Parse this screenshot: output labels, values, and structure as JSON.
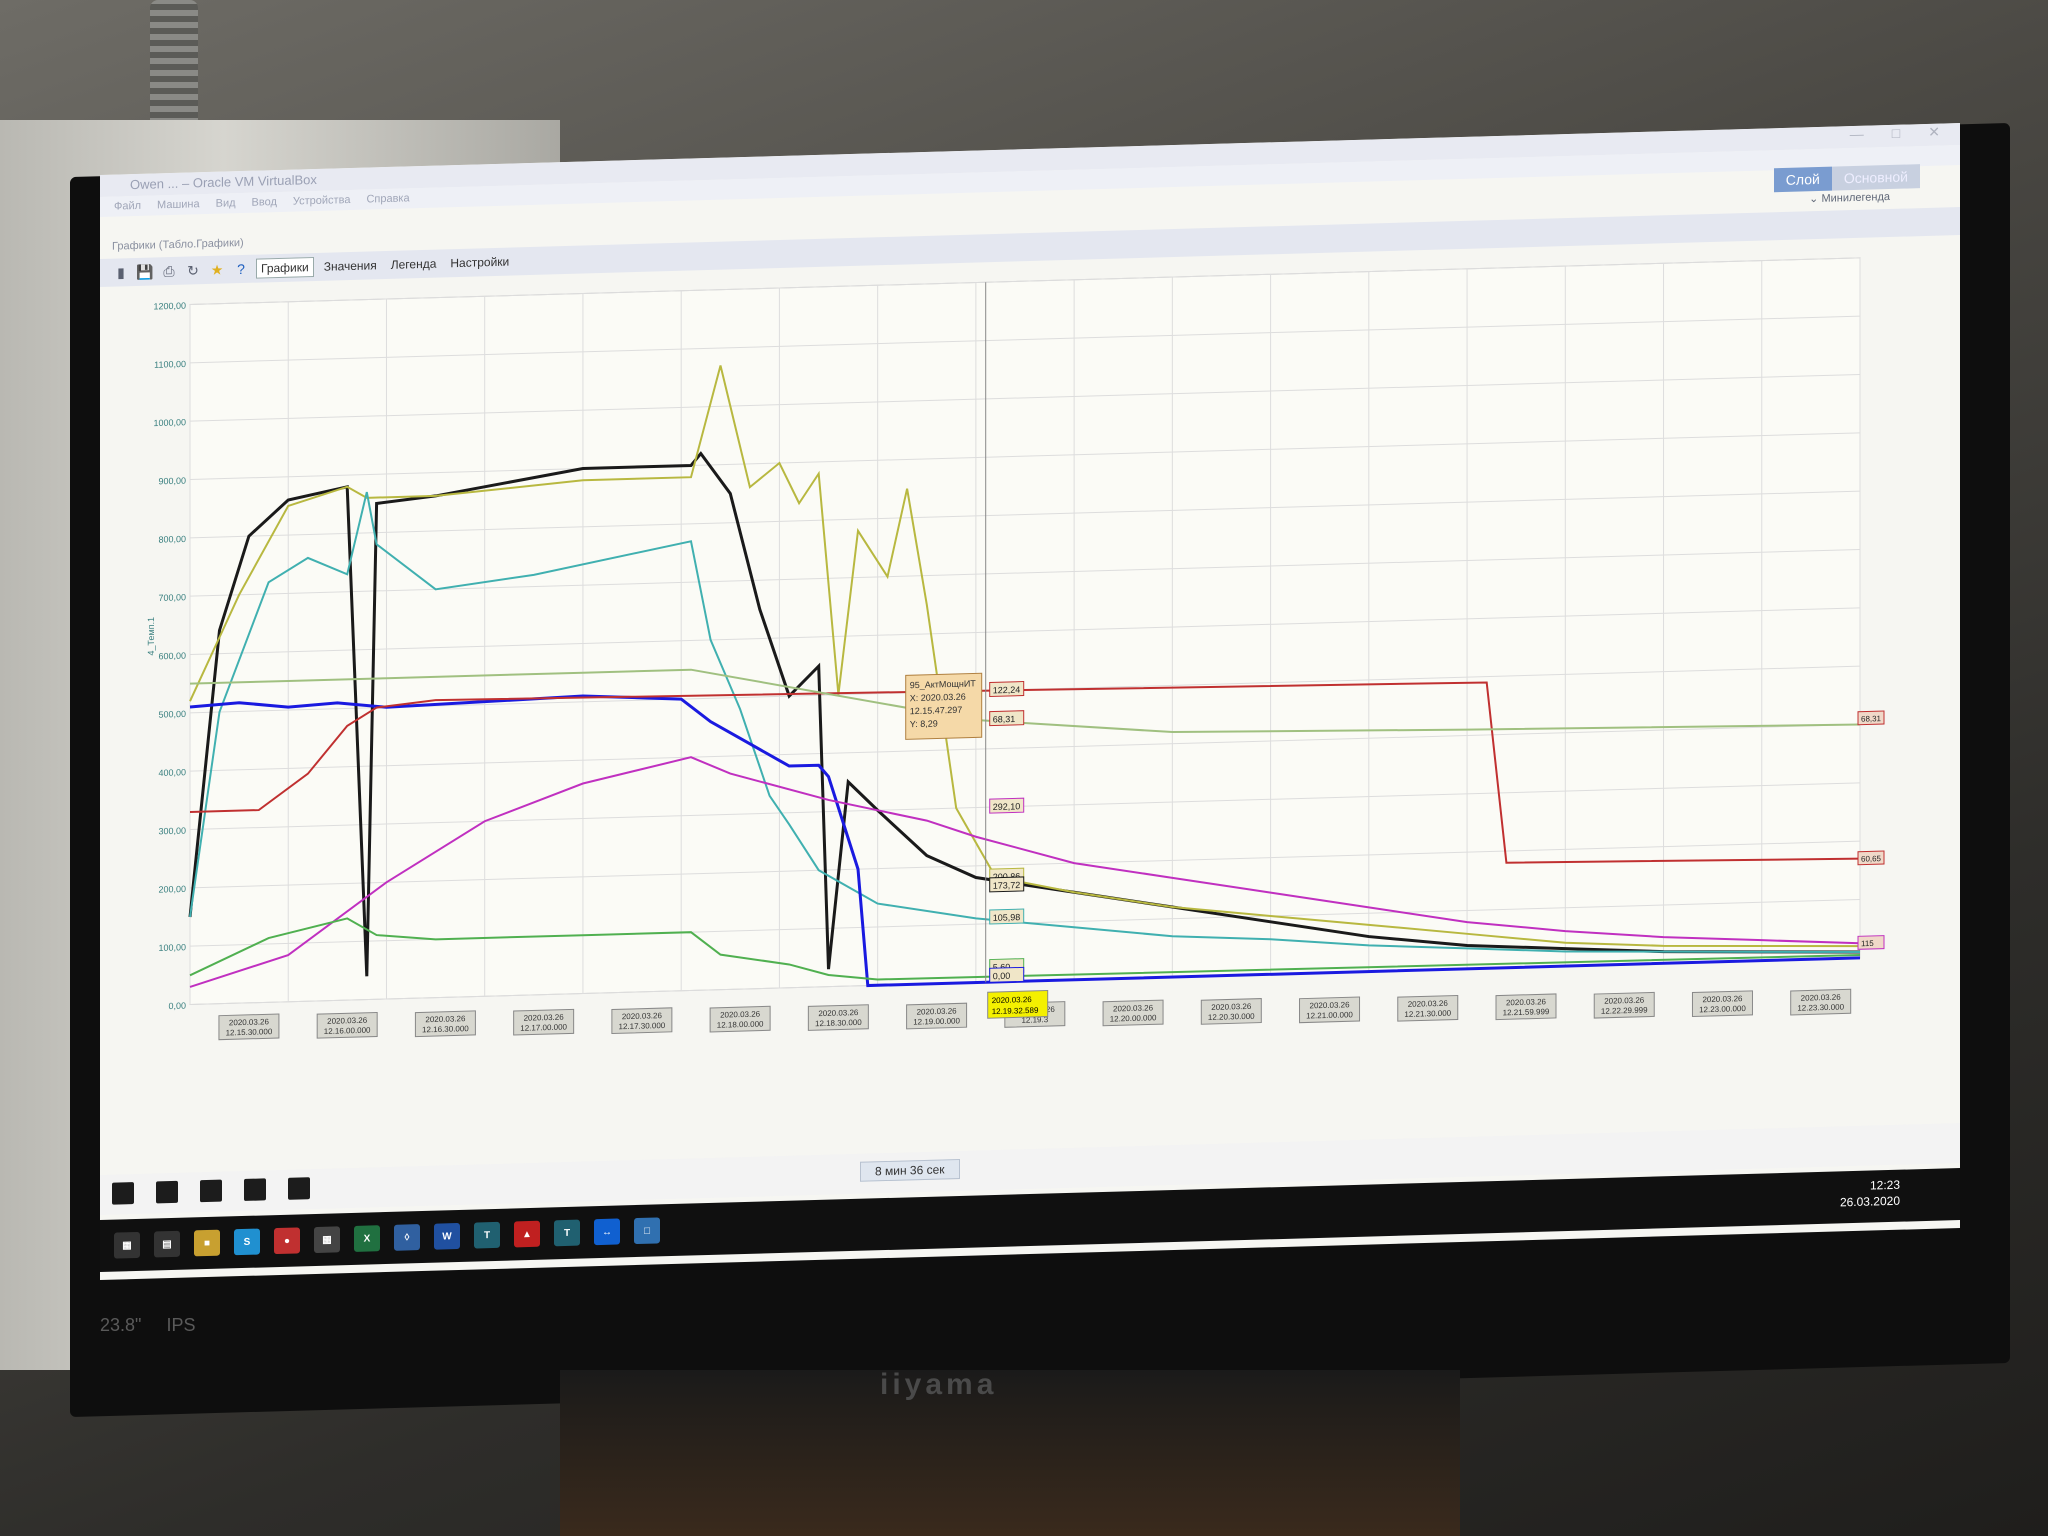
{
  "window": {
    "title": "Owen ... – Oracle VM VirtualBox",
    "menu": [
      "Файл",
      "Машина",
      "Вид",
      "Ввод",
      "Устройства",
      "Справка"
    ],
    "subtitle": "Графики (Табло.Графики)",
    "layer_buttons": [
      "Слой",
      "Основной"
    ],
    "mini_legend": "Минилегенда"
  },
  "toolbar": {
    "tabs": [
      "Графики",
      "Значения",
      "Легенда",
      "Настройки"
    ],
    "icons": [
      "signal-icon",
      "save-icon",
      "print-icon",
      "refresh-icon",
      "star-icon",
      "help-icon"
    ]
  },
  "tooltip": {
    "lines": [
      "95_АктМощнИТ",
      "X: 2020.03.26",
      "12.15.47.297",
      "Y: 8,29"
    ]
  },
  "cursor_value_labels": [
    "122,24",
    "68,31",
    "292,10",
    "200,86",
    "173,72",
    "105,98",
    "5,60",
    "0,00"
  ],
  "right_value_labels": [
    "68,31",
    "60,65",
    "115",
    "",
    "",
    ""
  ],
  "cursor_time": [
    "2020.03.26",
    "12.19.32.589"
  ],
  "duration": "8 мин 36 сек",
  "clock": {
    "time": "12:23",
    "date": "26.03.2020"
  },
  "bezel": {
    "size": "23.8\"",
    "brand": "iiyama",
    "panel": "IPS"
  },
  "colors": {
    "black": "#1a1a1a",
    "olive": "#b8b840",
    "teal": "#40b0b0",
    "blue": "#1a1ae0",
    "red": "#c03030",
    "magenta": "#c030c0",
    "green": "#50b050",
    "lightgreen": "#a0c080"
  },
  "chart_data": {
    "type": "line",
    "ylabel": "4_Темп.1",
    "ylim": [
      0,
      1200
    ],
    "y_ticks": [
      "0,00",
      "100,00",
      "200,00",
      "300,00",
      "400,00",
      "500,00",
      "600,00",
      "700,00",
      "800,00",
      "900,00",
      "1000,00",
      "1100,00",
      "1200,00"
    ],
    "x_ticks": [
      [
        "2020.03.26",
        "12.15.30.000"
      ],
      [
        "2020.03.26",
        "12.16.00.000"
      ],
      [
        "2020.03.26",
        "12.16.30.000"
      ],
      [
        "2020.03.26",
        "12.17.00.000"
      ],
      [
        "2020.03.26",
        "12.17.30.000"
      ],
      [
        "2020.03.26",
        "12.18.00.000"
      ],
      [
        "2020.03.26",
        "12.18.30.000"
      ],
      [
        "2020.03.26",
        "12.19.00.000"
      ],
      [
        "2020.03.26",
        "12.19.3"
      ],
      [
        "2020.03.26",
        "12.20.00.000"
      ],
      [
        "2020.03.26",
        "12.20.30.000"
      ],
      [
        "2020.03.26",
        "12.21.00.000"
      ],
      [
        "2020.03.26",
        "12.21.30.000"
      ],
      [
        "2020.03.26",
        "12.21.59.999"
      ],
      [
        "2020.03.26",
        "12.22.29.999"
      ],
      [
        "2020.03.26",
        "12.23.00.000"
      ],
      [
        "2020.03.26",
        "12.23.30.000"
      ]
    ],
    "x_range": [
      0,
      17
    ],
    "series": [
      {
        "color": "black",
        "points": [
          [
            0,
            150
          ],
          [
            0.3,
            640
          ],
          [
            0.6,
            800
          ],
          [
            1,
            860
          ],
          [
            1.6,
            880
          ],
          [
            1.8,
            40
          ],
          [
            1.9,
            850
          ],
          [
            2.5,
            860
          ],
          [
            4,
            900
          ],
          [
            5.1,
            900
          ],
          [
            5.2,
            920
          ],
          [
            5.5,
            850
          ],
          [
            5.8,
            650
          ],
          [
            6.1,
            500
          ],
          [
            6.4,
            550
          ],
          [
            6.5,
            30
          ],
          [
            6.7,
            350
          ],
          [
            7,
            300
          ],
          [
            7.5,
            220
          ],
          [
            8,
            180
          ],
          [
            9,
            150
          ],
          [
            10,
            120
          ],
          [
            11,
            90
          ],
          [
            12,
            60
          ],
          [
            13,
            40
          ],
          [
            14,
            30
          ],
          [
            15,
            20
          ],
          [
            16,
            15
          ],
          [
            17,
            10
          ]
        ]
      },
      {
        "color": "olive",
        "points": [
          [
            0,
            520
          ],
          [
            0.5,
            700
          ],
          [
            1,
            850
          ],
          [
            1.6,
            880
          ],
          [
            1.8,
            860
          ],
          [
            2.5,
            860
          ],
          [
            4,
            880
          ],
          [
            5.1,
            880
          ],
          [
            5.4,
            1070
          ],
          [
            5.7,
            860
          ],
          [
            6,
            900
          ],
          [
            6.2,
            830
          ],
          [
            6.4,
            880
          ],
          [
            6.6,
            500
          ],
          [
            6.8,
            780
          ],
          [
            7.1,
            700
          ],
          [
            7.3,
            850
          ],
          [
            7.5,
            650
          ],
          [
            7.8,
            300
          ],
          [
            8.2,
            180
          ],
          [
            9,
            150
          ],
          [
            10,
            120
          ],
          [
            11,
            100
          ],
          [
            12,
            80
          ],
          [
            13,
            60
          ],
          [
            14,
            40
          ],
          [
            15,
            30
          ],
          [
            16,
            25
          ],
          [
            17,
            20
          ]
        ]
      },
      {
        "color": "teal",
        "points": [
          [
            0,
            150
          ],
          [
            0.3,
            500
          ],
          [
            0.8,
            720
          ],
          [
            1.2,
            760
          ],
          [
            1.6,
            730
          ],
          [
            1.8,
            870
          ],
          [
            1.9,
            780
          ],
          [
            2.5,
            700
          ],
          [
            3.5,
            720
          ],
          [
            5.1,
            770
          ],
          [
            5.3,
            600
          ],
          [
            5.6,
            480
          ],
          [
            5.9,
            330
          ],
          [
            6.1,
            280
          ],
          [
            6.4,
            200
          ],
          [
            6.6,
            180
          ],
          [
            7,
            140
          ],
          [
            8,
            110
          ],
          [
            9,
            90
          ],
          [
            10,
            70
          ],
          [
            11,
            60
          ],
          [
            12,
            45
          ],
          [
            13,
            35
          ],
          [
            14,
            25
          ],
          [
            15,
            20
          ],
          [
            16,
            15
          ],
          [
            17,
            10
          ]
        ]
      },
      {
        "color": "blue",
        "points": [
          [
            0,
            510
          ],
          [
            0.5,
            515
          ],
          [
            1,
            505
          ],
          [
            1.5,
            510
          ],
          [
            2,
            500
          ],
          [
            3,
            505
          ],
          [
            4,
            510
          ],
          [
            5,
            500
          ],
          [
            5.3,
            460
          ],
          [
            5.7,
            420
          ],
          [
            6.1,
            380
          ],
          [
            6.4,
            380
          ],
          [
            6.5,
            360
          ],
          [
            6.8,
            200
          ],
          [
            6.9,
            0
          ],
          [
            17,
            0
          ]
        ]
      },
      {
        "color": "red",
        "points": [
          [
            0,
            330
          ],
          [
            0.7,
            330
          ],
          [
            1.2,
            390
          ],
          [
            1.6,
            470
          ],
          [
            1.9,
            500
          ],
          [
            2.5,
            510
          ],
          [
            8,
            500
          ],
          [
            13.2,
            490
          ],
          [
            13.4,
            180
          ],
          [
            17,
            170
          ]
        ]
      },
      {
        "color": "magenta",
        "points": [
          [
            0,
            30
          ],
          [
            1,
            80
          ],
          [
            2,
            200
          ],
          [
            3,
            300
          ],
          [
            4,
            360
          ],
          [
            5.1,
            400
          ],
          [
            5.5,
            370
          ],
          [
            6.5,
            320
          ],
          [
            7.5,
            280
          ],
          [
            8,
            250
          ],
          [
            9,
            200
          ],
          [
            10,
            170
          ],
          [
            11,
            140
          ],
          [
            12,
            110
          ],
          [
            13,
            80
          ],
          [
            14,
            60
          ],
          [
            15,
            45
          ],
          [
            16,
            35
          ],
          [
            17,
            25
          ]
        ]
      },
      {
        "color": "green",
        "points": [
          [
            0,
            50
          ],
          [
            0.8,
            110
          ],
          [
            1.6,
            140
          ],
          [
            1.9,
            110
          ],
          [
            2.5,
            100
          ],
          [
            4,
            100
          ],
          [
            5.1,
            100
          ],
          [
            5.4,
            60
          ],
          [
            6.1,
            40
          ],
          [
            6.5,
            20
          ],
          [
            7,
            10
          ],
          [
            17,
            5
          ]
        ]
      },
      {
        "color": "lightgreen",
        "points": [
          [
            0,
            550
          ],
          [
            1,
            550
          ],
          [
            2,
            550
          ],
          [
            4,
            550
          ],
          [
            5.1,
            550
          ],
          [
            8,
            450
          ],
          [
            10,
            420
          ],
          [
            13,
            410
          ],
          [
            17,
            400
          ]
        ]
      }
    ]
  }
}
